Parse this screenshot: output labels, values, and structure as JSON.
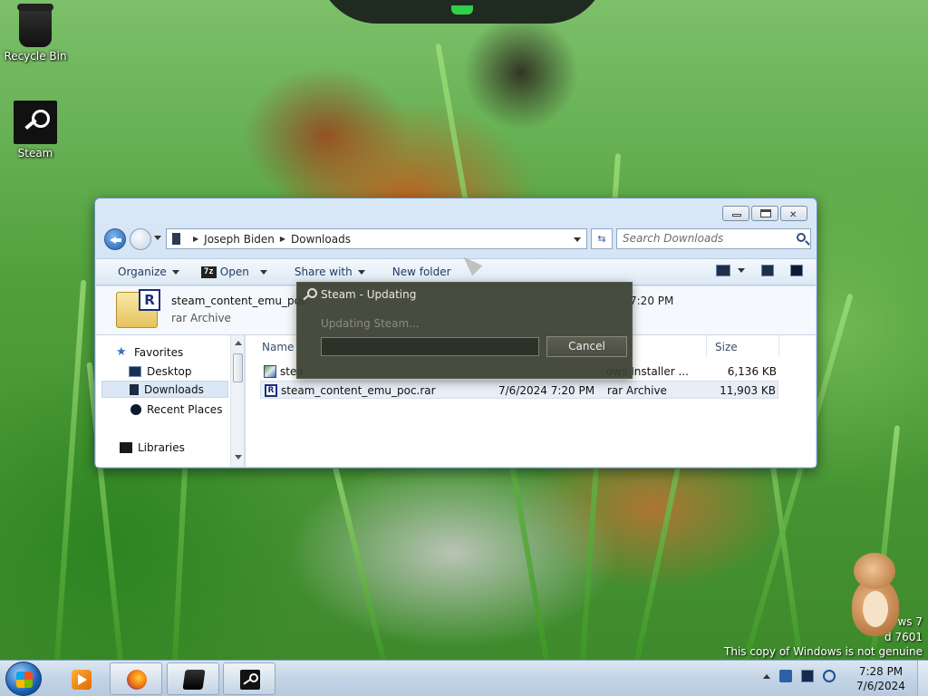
{
  "desktop": {
    "icons": [
      {
        "label": "Recycle Bin",
        "icon": "recycle-bin-icon"
      },
      {
        "label": "Steam",
        "icon": "steam-icon"
      }
    ],
    "watermark_lines": [
      "ws 7",
      "d 7601",
      "This copy of Windows is not genuine"
    ]
  },
  "explorer": {
    "breadcrumb": [
      "Joseph Biden",
      "Downloads"
    ],
    "search_placeholder": "Search Downloads",
    "toolbar": {
      "organize": "Organize",
      "open": "Open",
      "open_icon_text": "7z",
      "share_with": "Share with",
      "new_folder": "New folder"
    },
    "details": {
      "name": "steam_content_emu_poc",
      "type": "rar Archive",
      "date": "7:20 PM",
      "icon_letter": "R"
    },
    "nav": {
      "favorites": "Favorites",
      "desktop": "Desktop",
      "downloads": "Downloads",
      "recent_places": "Recent Places",
      "libraries": "Libraries"
    },
    "columns": {
      "name": "Name",
      "size": "Size"
    },
    "files": [
      {
        "name": "stea",
        "date": "",
        "type": "ows Installer ...",
        "size": "6,136 KB",
        "icon": "installer-icon"
      },
      {
        "name": "steam_content_emu_poc.rar",
        "date": "7/6/2024 7:20 PM",
        "type": "rar Archive",
        "size": "11,903 KB",
        "icon": "rar-icon",
        "icon_letter": "R"
      }
    ]
  },
  "steam_dialog": {
    "title": "Steam - Updating",
    "status": "Updating Steam...",
    "progress": 0,
    "cancel_label": "Cancel"
  },
  "taskbar": {
    "apps": [
      {
        "name": "Windows Media Player",
        "icon": "media-player-icon"
      },
      {
        "name": "Firefox",
        "icon": "firefox-icon"
      },
      {
        "name": "Box",
        "icon": "box-app-icon"
      },
      {
        "name": "Steam",
        "icon": "steam-icon"
      }
    ],
    "clock": {
      "time": "7:28 PM",
      "date": "7/6/2024"
    }
  },
  "colors": {
    "taskbar": "#c3d4e6",
    "steam_dialog_bg": "#3a3e30",
    "explorer_frame": "#c7dbef",
    "selection": "#dbe7f5"
  }
}
